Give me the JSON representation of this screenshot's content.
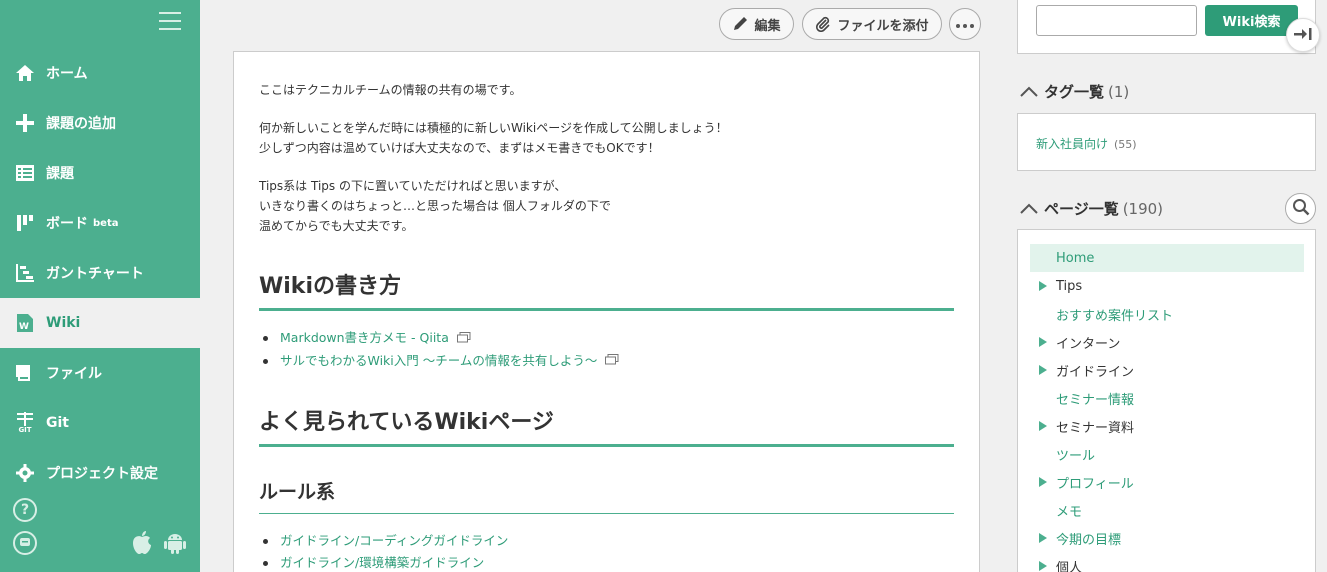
{
  "sidebar": {
    "items": [
      {
        "label": "ホーム",
        "icon": "home-icon"
      },
      {
        "label": "課題の追加",
        "icon": "plus-icon"
      },
      {
        "label": "課題",
        "icon": "list-icon"
      },
      {
        "label": "ボード",
        "badge": "beta",
        "icon": "board-icon"
      },
      {
        "label": "ガントチャート",
        "icon": "gantt-icon"
      },
      {
        "label": "Wiki",
        "icon": "wiki-icon"
      },
      {
        "label": "ファイル",
        "icon": "file-icon"
      },
      {
        "label": "Git",
        "sub": "GIT",
        "icon": "git-icon"
      },
      {
        "label": "プロジェクト設定",
        "icon": "gear-icon"
      }
    ],
    "help": "?"
  },
  "toolbar": {
    "edit_label": "編集",
    "attach_label": "ファイルを添付"
  },
  "content": {
    "intro": "ここはテクニカルチームの情報の共有の場です。",
    "para2_line1": "何か新しいことを学んだ時には積極的に新しいWikiページを作成して公開しましょう！",
    "para2_line2": "少しずつ内容は温めていけば大丈夫なので、まずはメモ書きでもOKです！",
    "para3_line1": "Tips系は Tips の下に置いていただければと思いますが、",
    "para3_line2": "いきなり書くのはちょっと…と思った場合は 個人フォルダの下で",
    "para3_line3": "温めてからでも大丈夫です。",
    "h_howto": "Wikiの書き方",
    "howto_links": [
      "Markdown書き方メモ - Qiita",
      "サルでもわかるWiki入門 〜チームの情報を共有しよう〜"
    ],
    "h_popular": "よく見られているWikiページ",
    "h_rules": "ルール系",
    "rule_links": [
      "ガイドライン/コーディングガイドライン",
      "ガイドライン/環境構築ガイドライン"
    ]
  },
  "right": {
    "search_button": "Wiki検索",
    "search_value": "",
    "tags_title": "タグ一覧",
    "tags_count": "(1)",
    "tag_label": "新入社員向け",
    "tag_count": "(55)",
    "pages_title": "ページ一覧",
    "pages_count": "(190)",
    "pages": [
      {
        "label": "Home",
        "expandable": false,
        "link": true,
        "selected": true
      },
      {
        "label": "Tips",
        "expandable": true,
        "link": false
      },
      {
        "label": "おすすめ案件リスト",
        "expandable": false,
        "link": true
      },
      {
        "label": "インターン",
        "expandable": true,
        "link": false
      },
      {
        "label": "ガイドライン",
        "expandable": true,
        "link": false
      },
      {
        "label": "セミナー情報",
        "expandable": false,
        "link": true
      },
      {
        "label": "セミナー資料",
        "expandable": true,
        "link": false
      },
      {
        "label": "ツール",
        "expandable": false,
        "link": true
      },
      {
        "label": "プロフィール",
        "expandable": true,
        "link": true
      },
      {
        "label": "メモ",
        "expandable": false,
        "link": true
      },
      {
        "label": "今期の目標",
        "expandable": true,
        "link": true
      },
      {
        "label": "個人",
        "expandable": true,
        "link": false
      }
    ]
  },
  "colors": {
    "brand": "#4caf8f",
    "accent": "#2e9c78"
  }
}
